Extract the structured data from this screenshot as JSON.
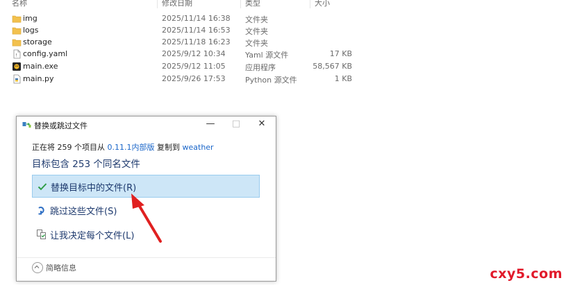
{
  "explorer": {
    "columns": {
      "name": "名称",
      "modified": "修改日期",
      "type": "类型",
      "size": "大小"
    },
    "files": [
      {
        "name": "img",
        "date": "2025/11/14 16:38",
        "type": "文件夹",
        "size": "",
        "icon": "folder-icon"
      },
      {
        "name": "logs",
        "date": "2025/11/14 16:53",
        "type": "文件夹",
        "size": "",
        "icon": "folder-icon"
      },
      {
        "name": "storage",
        "date": "2025/11/18 16:23",
        "type": "文件夹",
        "size": "",
        "icon": "folder-icon"
      },
      {
        "name": "config.yaml",
        "date": "2025/9/12 10:34",
        "type": "Yaml 源文件",
        "size": "17 KB",
        "icon": "document-icon"
      },
      {
        "name": "main.exe",
        "date": "2025/9/12 11:05",
        "type": "应用程序",
        "size": "58,567 KB",
        "icon": "application-icon"
      },
      {
        "name": "main.py",
        "date": "2025/9/26 17:53",
        "type": "Python 源文件",
        "size": "1 KB",
        "icon": "python-file-icon"
      }
    ]
  },
  "dialog": {
    "title": "替换或跳过文件",
    "window_buttons": {
      "minimize": "—",
      "maximize": "□",
      "close": "✕"
    },
    "progress": {
      "prefix": "正在将 259 个项目从 ",
      "source": "0.11.1内部版",
      "middle": " 复制到 ",
      "destination": "weather"
    },
    "headline": "目标包含 253 个同名文件",
    "options": [
      {
        "label": "替换目标中的文件(R)",
        "icon": "checkmark-icon"
      },
      {
        "label": "跳过这些文件(S)",
        "icon": "skip-icon"
      },
      {
        "label": "让我决定每个文件(L)",
        "icon": "decide-each-icon"
      }
    ],
    "details_label": "简略信息"
  },
  "annotation": {
    "arrow_color": "#e02020"
  },
  "watermark": "cxy5.com"
}
